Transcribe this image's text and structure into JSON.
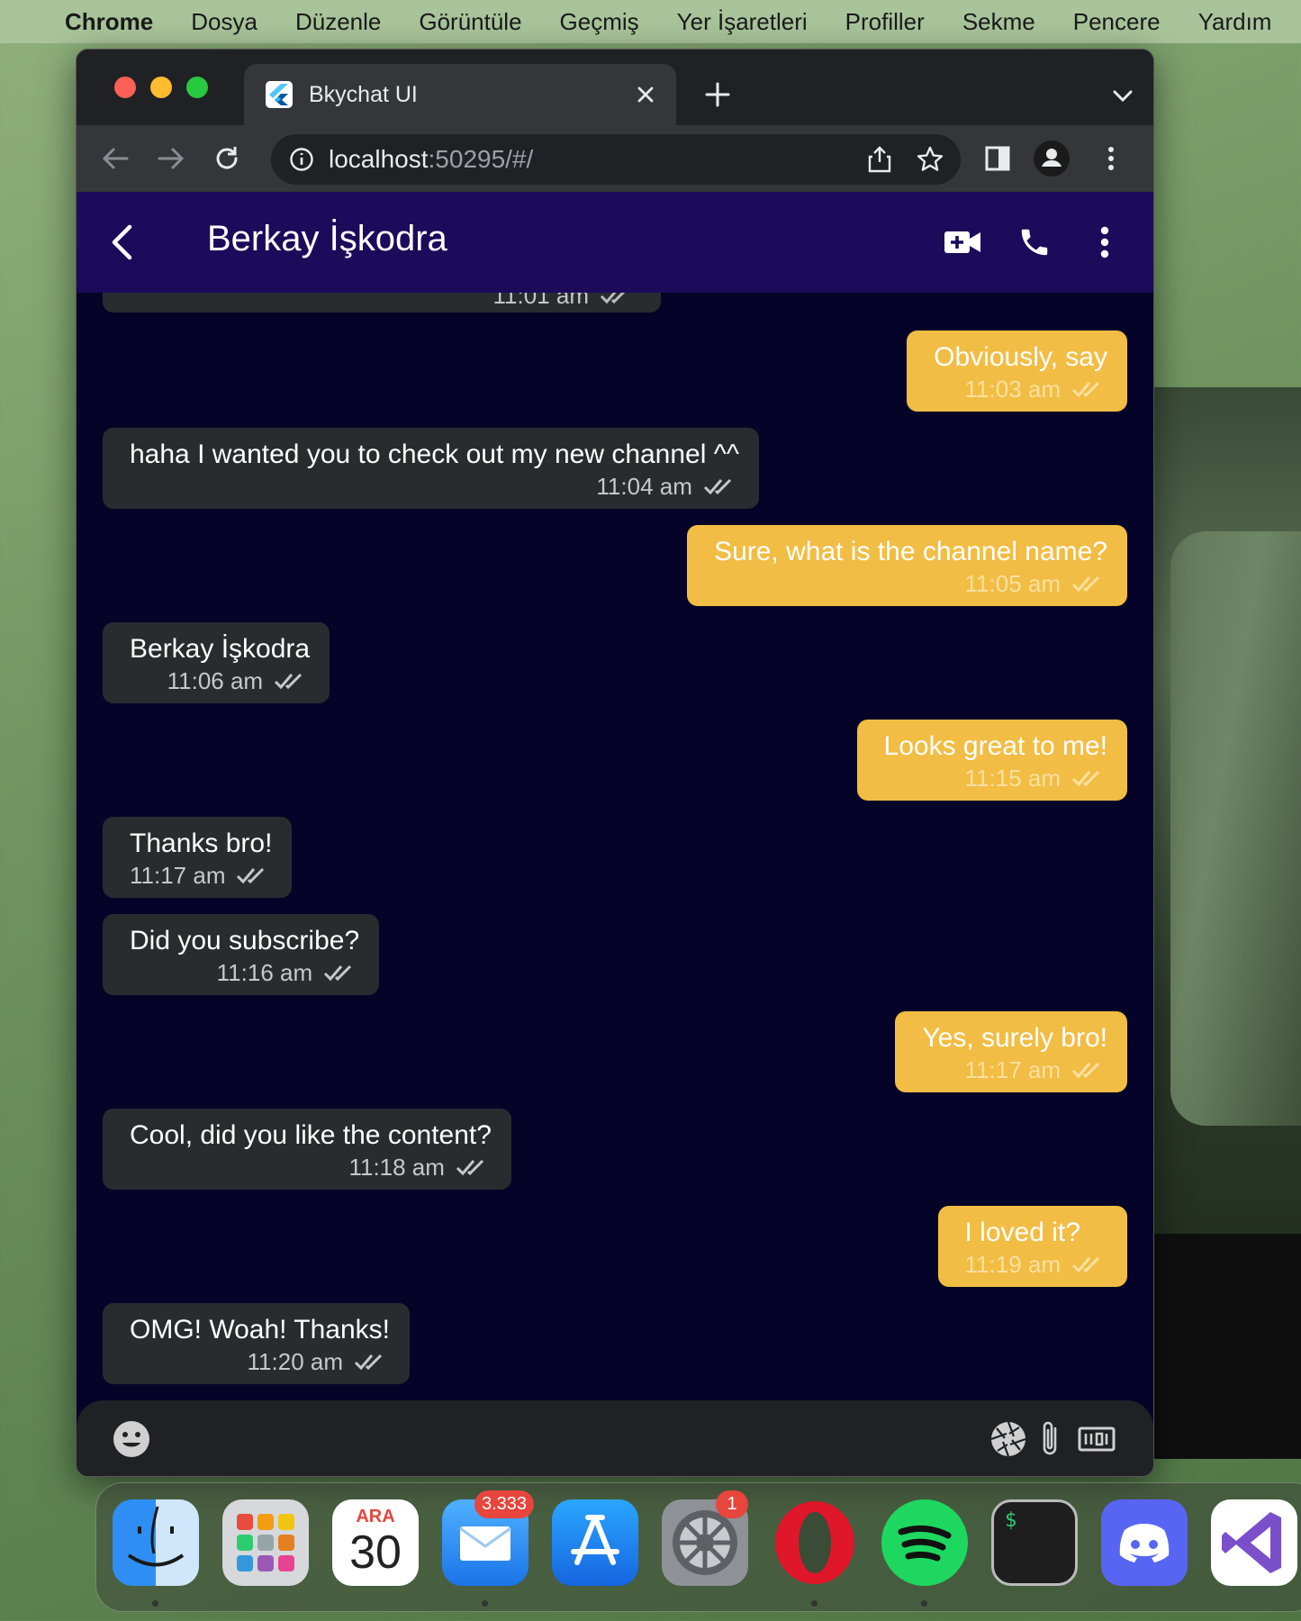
{
  "menubar": {
    "app_name": "Chrome",
    "items": [
      "Dosya",
      "Düzenle",
      "Görüntüle",
      "Geçmiş",
      "Yer İşaretleri",
      "Profiller",
      "Sekme",
      "Pencere",
      "Yardım"
    ]
  },
  "browser": {
    "tab_title": "Bkychat UI",
    "url_host": "localhost",
    "url_rest": ":50295/#/"
  },
  "chat": {
    "contact_name": "Berkay İşkodra",
    "partial_time": "11:01 am",
    "messages": [
      {
        "dir": "out",
        "text": "Obviously, say",
        "time": "11:03 am"
      },
      {
        "dir": "in",
        "text": "haha I wanted you to check out my new channel ^^",
        "time": "11:04 am"
      },
      {
        "dir": "out",
        "text": "Sure, what is the channel name?",
        "time": "11:05 am"
      },
      {
        "dir": "in",
        "text": "Berkay İşkodra",
        "time": "11:06 am"
      },
      {
        "dir": "out",
        "text": "Looks great to me!",
        "time": "11:15 am"
      },
      {
        "dir": "in",
        "text": "Thanks bro!",
        "time": "11:17 am"
      },
      {
        "dir": "in",
        "text": "Did you subscribe?",
        "time": "11:16 am"
      },
      {
        "dir": "out",
        "text": "Yes, surely bro!",
        "time": "11:17 am"
      },
      {
        "dir": "in",
        "text": "Cool, did you like the content?",
        "time": "11:18 am"
      },
      {
        "dir": "out",
        "text": "I loved it?",
        "time": "11:19 am"
      },
      {
        "dir": "in",
        "text": "OMG! Woah! Thanks!",
        "time": "11:20 am"
      }
    ]
  },
  "dock": {
    "calendar_month": "ARA",
    "calendar_day": "30",
    "mail_badge": "3.333",
    "settings_badge": "1",
    "terminal_prompt": "$"
  },
  "colors": {
    "appbar": "#1c0a5a",
    "chat_bg": "#050428",
    "incoming_bubble": "#2a2b2f",
    "outgoing_bubble": "#f2bd44"
  }
}
